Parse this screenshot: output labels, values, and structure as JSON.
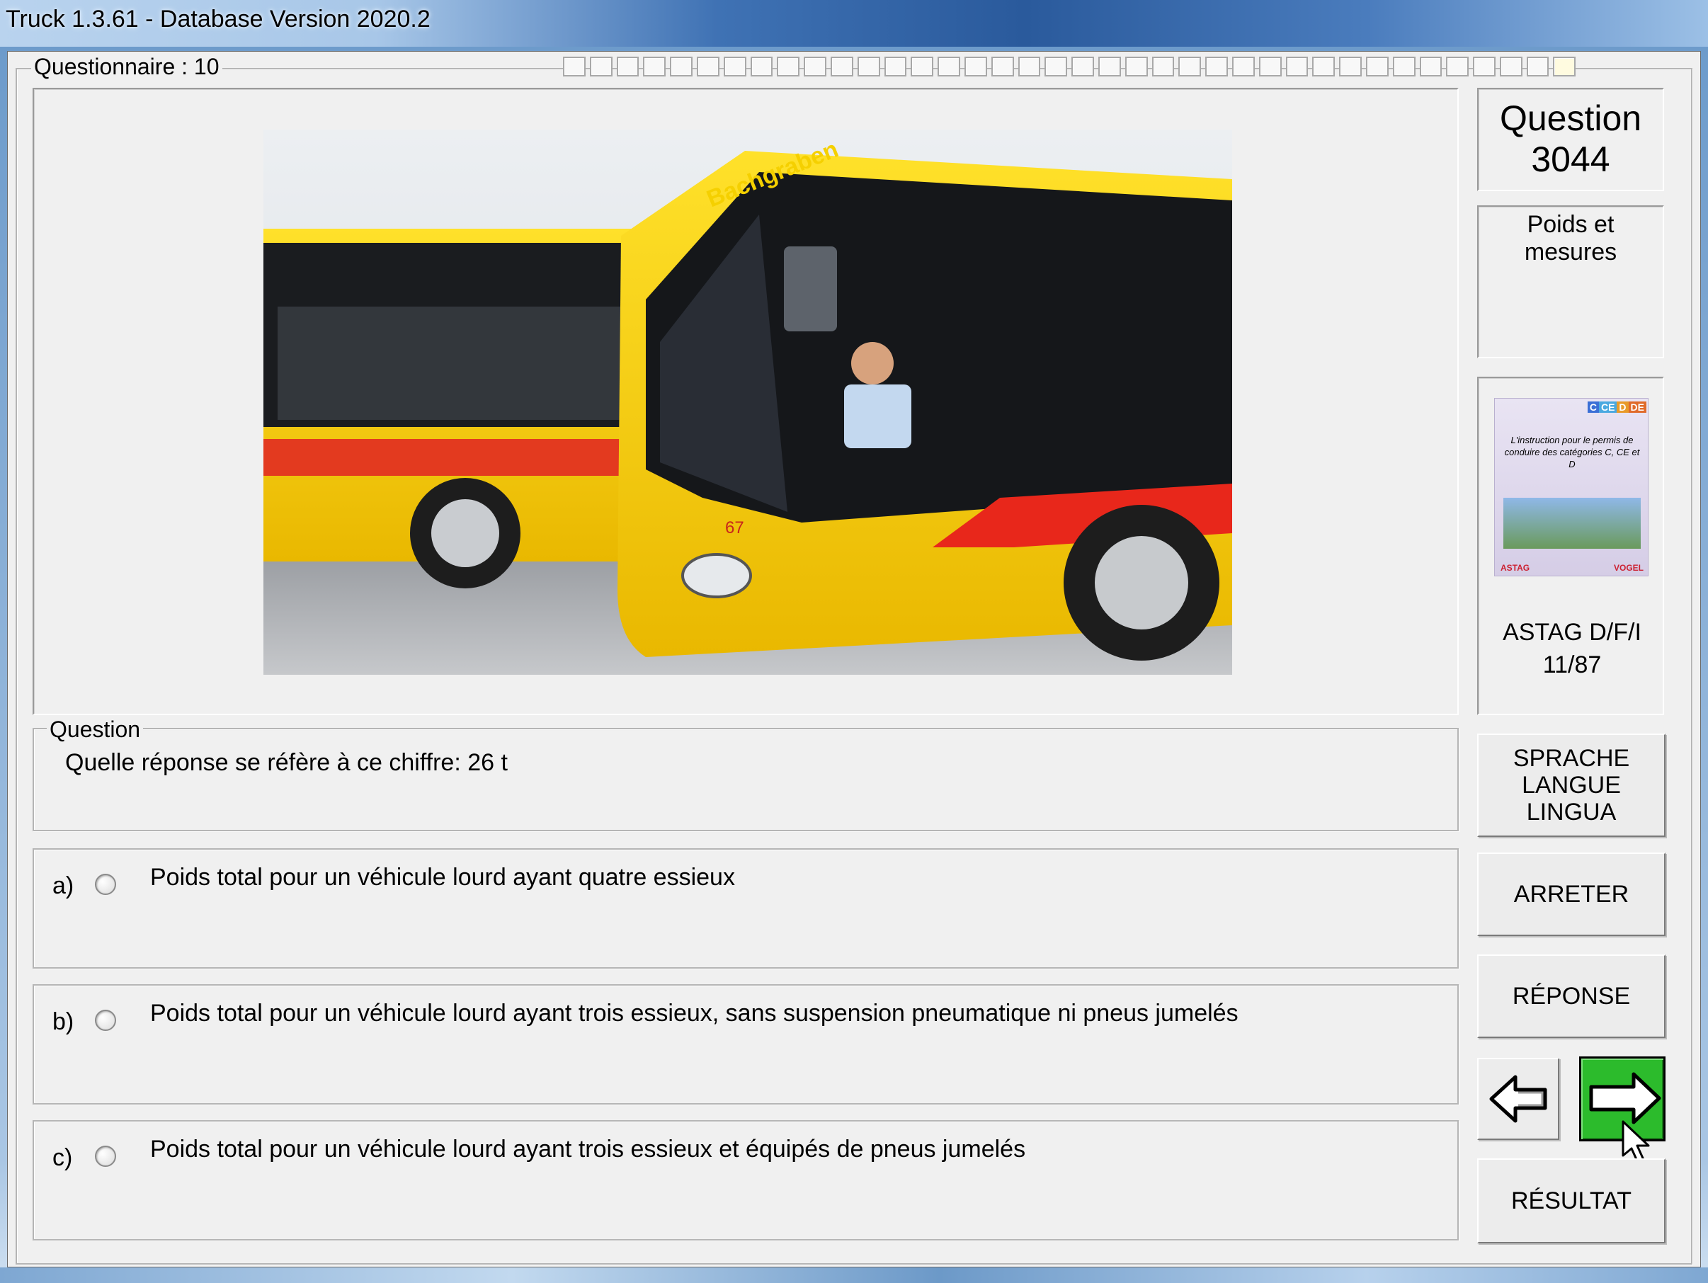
{
  "window": {
    "title": "Truck 1.3.61 - Database Version 2020.2"
  },
  "questionnaire": {
    "label": "Questionnaire : 10",
    "total_ticks": 38,
    "current_tick": 38
  },
  "question_panel": {
    "number_label": "Question",
    "number": "3044",
    "category": "Poids et mesures"
  },
  "book": {
    "tags": [
      "C",
      "CE",
      "D",
      "DE"
    ],
    "tag_colors": [
      "#3b6fd6",
      "#4aa8e0",
      "#e89a2a",
      "#e06a2a"
    ],
    "cover_text": "L'instruction pour le permis de conduire des catégories C, CE et D",
    "publisher_left": "ASTAG",
    "publisher_right": "VOGEL",
    "source": "ASTAG D/F/I",
    "page": "11/87"
  },
  "question": {
    "legend": "Question",
    "text": "Quelle réponse se réfère à ce chiffre: 26 t"
  },
  "answers": [
    {
      "letter": "a)",
      "text": "Poids total pour un véhicule lourd ayant quatre essieux",
      "selected": false
    },
    {
      "letter": "b)",
      "text": "Poids total pour un véhicule lourd ayant trois essieux, sans suspension pneumatique ni pneus jumelés",
      "selected": false
    },
    {
      "letter": "c)",
      "text": "Poids total pour un véhicule lourd ayant trois essieux et équipés de pneus jumelés",
      "selected": false
    }
  ],
  "buttons": {
    "language": [
      "SPRACHE",
      "LANGUE",
      "LINGUA"
    ],
    "stop": "ARRETER",
    "answer": "RÉPONSE",
    "result": "RÉSULTAT",
    "prev_icon": "arrow-left-icon",
    "next_icon": "arrow-right-icon",
    "next_color": "#2cbb2c"
  },
  "photo": {
    "front_bus_route_sign": "Bachgraben",
    "front_bus_route_number": "67",
    "bus_color": "#f5d000",
    "stripe_color": "#e8271b"
  }
}
